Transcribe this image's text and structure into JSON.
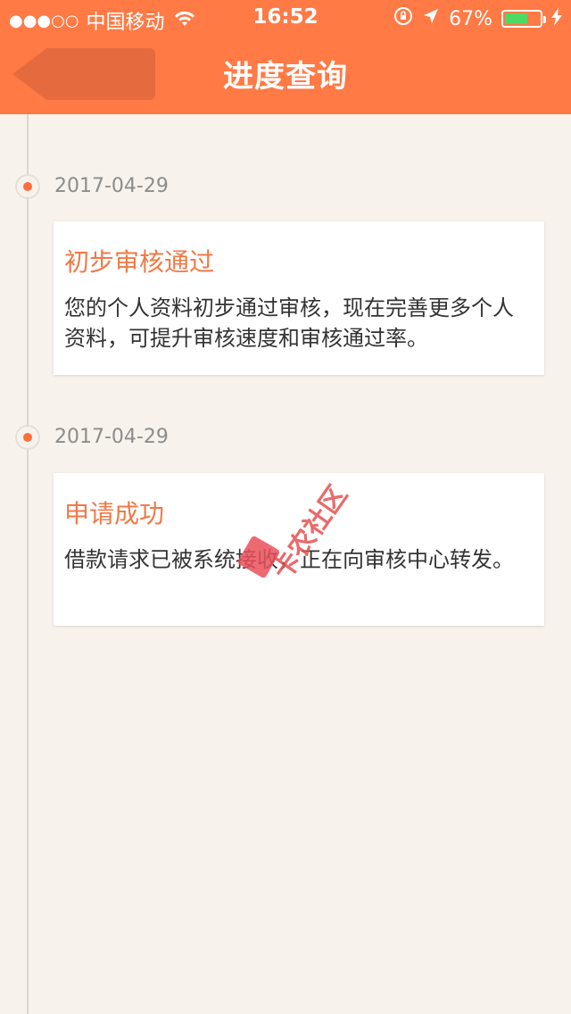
{
  "status_bar": {
    "signal_dots": "●●●○○",
    "carrier": "中国移动",
    "time": "16:52",
    "battery_percent": "67%",
    "battery_level": 0.67,
    "icons": [
      "wifi-icon",
      "rotation-lock-icon",
      "location-arrow-icon",
      "battery-icon",
      "charging-bolt-icon"
    ]
  },
  "header": {
    "title": "进度查询",
    "background_color": "#ff7a45",
    "back_icon": "back-arrow-icon"
  },
  "timeline": [
    {
      "date": "2017-04-29",
      "title": "初步审核通过",
      "body": "您的个人资料初步通过审核，现在完善更多个人资料，可提升审核速度和审核通过率。"
    },
    {
      "date": "2017-04-29",
      "title": "申请成功",
      "body": "借款请求已被系统接收，正在向审核中心转发。"
    }
  ],
  "watermark": {
    "text": "卡农社区"
  },
  "colors": {
    "accent": "#ff7a45",
    "node_dot": "#ff6d3a",
    "card_title": "#ef7a47",
    "page_bg": "#f7f3ec"
  }
}
